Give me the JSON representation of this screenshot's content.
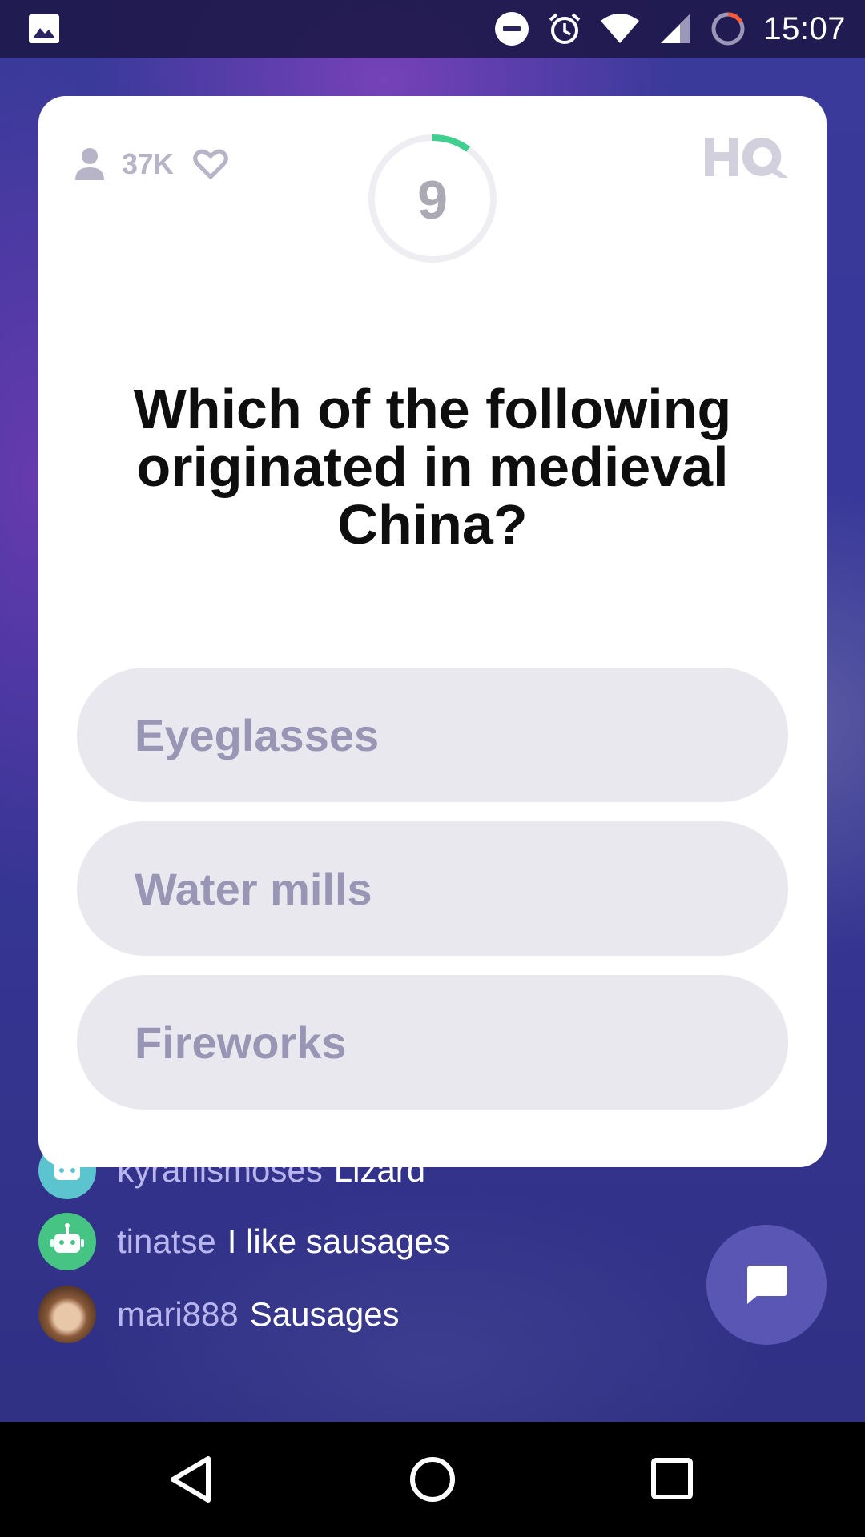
{
  "status_bar": {
    "time": "15:07",
    "icons": [
      "image-icon",
      "dnd-icon",
      "alarm-icon",
      "wifi-icon",
      "signal-icon",
      "battery-icon"
    ]
  },
  "card": {
    "viewer_count": "37K",
    "timer_value": "9",
    "timer_progress": 0.1,
    "logo": "HQ",
    "question": "Which of the following originated in medieval China?",
    "answers": [
      "Eyeglasses",
      "Water mills",
      "Fireworks"
    ]
  },
  "chat": {
    "messages": [
      {
        "user": "kyranismoses",
        "text": "Lizard",
        "avatar": "robot-icon",
        "avatar_color": "#5cc4cf"
      },
      {
        "user": "tinatse",
        "text": "I like sausages",
        "avatar": "robot-icon",
        "avatar_color": "#46c483"
      },
      {
        "user": "mari888",
        "text": "Sausages",
        "avatar": "photo-avatar",
        "avatar_color": "#b78a6a"
      }
    ],
    "fab_icon": "chat-bubble-icon"
  },
  "nav_bar": {
    "buttons": [
      "back-icon",
      "home-icon",
      "recents-icon"
    ]
  },
  "colors": {
    "timer_arc": "#3fcf8e",
    "answer_bg": "#e9e8ef",
    "answer_text": "#9896b4",
    "chat_user": "#b9b6ee",
    "fab_bg": "#5a56b4"
  }
}
